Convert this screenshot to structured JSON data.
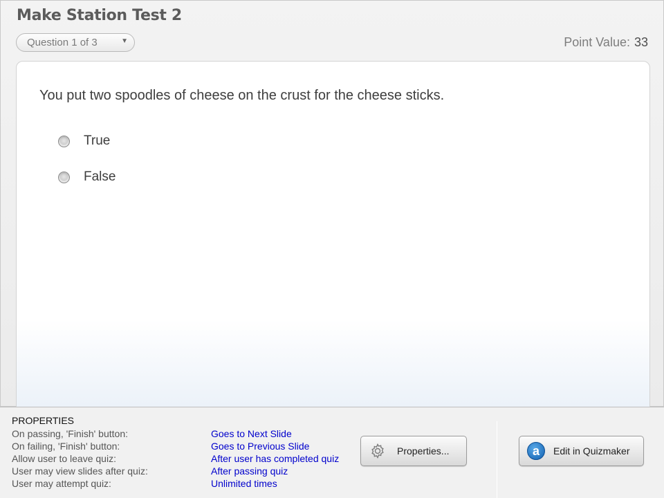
{
  "quiz": {
    "title": "Make Station Test 2",
    "question_selector": "Question 1 of 3",
    "point_value_label": "Point Value:",
    "point_value": "33",
    "question_text": "You put two spoodles of cheese on the crust for the cheese sticks.",
    "choices": [
      {
        "label": "True",
        "selected": false
      },
      {
        "label": "False",
        "selected": false
      }
    ]
  },
  "properties": {
    "heading": "PROPERTIES",
    "rows": [
      {
        "key": "On passing, 'Finish' button:",
        "value": "Goes to Next Slide"
      },
      {
        "key": "On failing, 'Finish' button:",
        "value": "Goes to Previous Slide"
      },
      {
        "key": "Allow user to leave quiz:",
        "value": "After user has completed quiz"
      },
      {
        "key": "User may view slides after quiz:",
        "value": "After passing quiz"
      },
      {
        "key": "User may attempt quiz:",
        "value": "Unlimited times"
      }
    ],
    "properties_button": "Properties...",
    "edit_button": "Edit in Quizmaker",
    "edit_icon_letter": "a"
  },
  "colors": {
    "value_text": "#0000cc",
    "title_text": "#5b5b5b"
  }
}
